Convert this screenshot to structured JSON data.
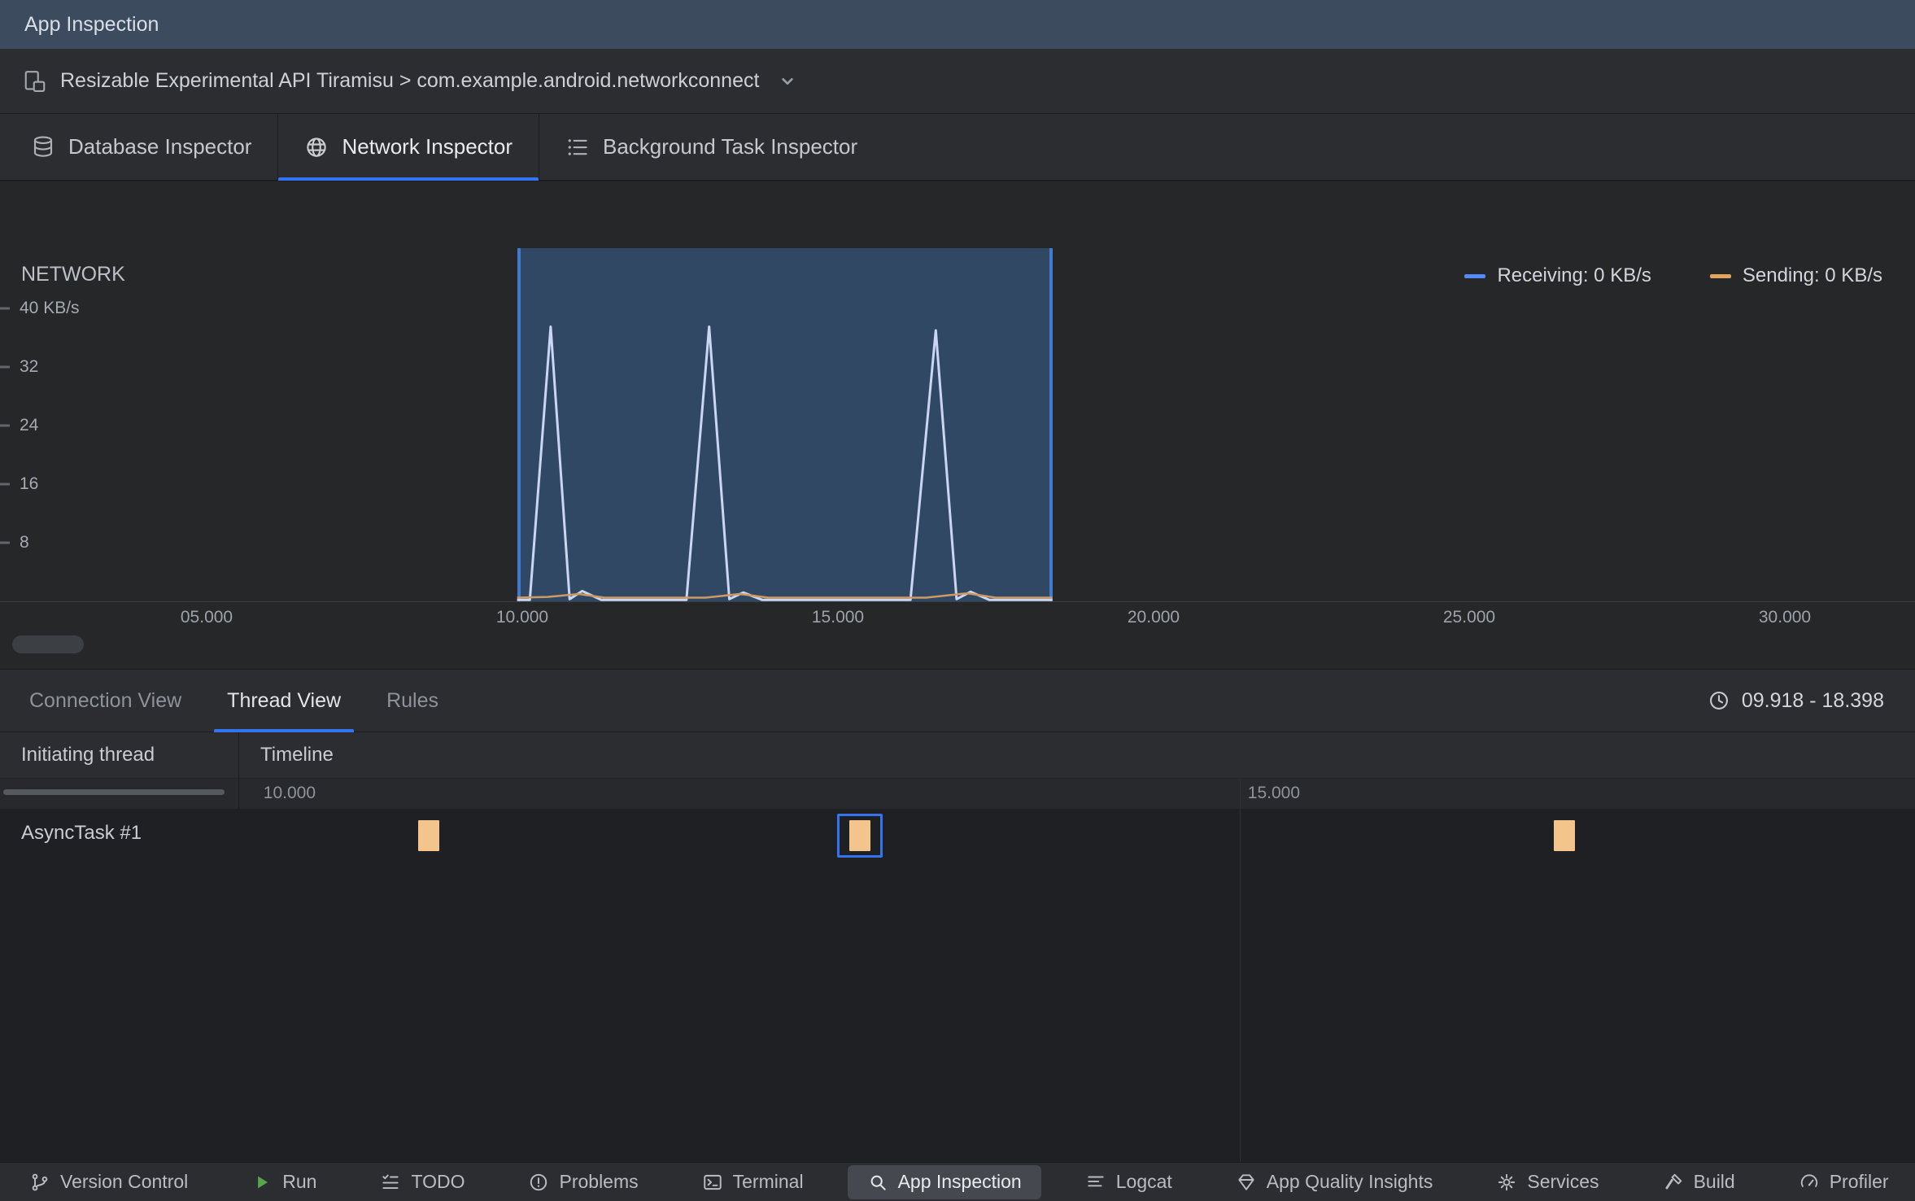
{
  "window": {
    "title": "App Inspection"
  },
  "process_bar": {
    "icon": "device-icon",
    "device_process": "Resizable Experimental API Tiramisu > com.example.android.networkconnect",
    "dropdown_icon": "chevron-down-icon"
  },
  "inspector_tabs": {
    "tabs": [
      {
        "label": "Database Inspector",
        "icon": "database-icon",
        "selected": false
      },
      {
        "label": "Network Inspector",
        "icon": "globe-icon",
        "selected": true
      },
      {
        "label": "Background Task Inspector",
        "icon": "checklist-icon",
        "selected": false
      }
    ]
  },
  "network": {
    "title": "NETWORK",
    "legend": [
      {
        "label": "Receiving: 0 KB/s",
        "color": "#548AF7"
      },
      {
        "label": "Sending: 0 KB/s",
        "color": "#E0A45C"
      }
    ]
  },
  "chart_data": {
    "type": "line",
    "title": "NETWORK",
    "ylabel": "KB/s",
    "ylim": [
      0,
      44
    ],
    "xlim_seconds": [
      3.7,
      32.0
    ],
    "grid": false,
    "legend_position": "top-right",
    "y_axis": {
      "ticks": [
        {
          "value": 8,
          "label": "8"
        },
        {
          "value": 16,
          "label": "16"
        },
        {
          "value": 24,
          "label": "24"
        },
        {
          "value": 32,
          "label": "32"
        },
        {
          "value": 40,
          "label": "40 KB/s"
        }
      ]
    },
    "x_axis": {
      "ticks": [
        {
          "value": 5,
          "label": "05.000"
        },
        {
          "value": 10,
          "label": "10.000"
        },
        {
          "value": 15,
          "label": "15.000"
        },
        {
          "value": 20,
          "label": "20.000"
        },
        {
          "value": 25,
          "label": "25.000"
        },
        {
          "value": 30,
          "label": "30.000"
        }
      ]
    },
    "selection": {
      "start": 9.918,
      "end": 18.398
    },
    "series": [
      {
        "name": "Receiving",
        "unit": "KB/s",
        "color": "#C9D7F2",
        "current_value": 0,
        "points": [
          [
            9.918,
            0.2
          ],
          [
            10.12,
            0.2
          ],
          [
            10.45,
            37.5
          ],
          [
            10.75,
            0.3
          ],
          [
            10.95,
            1.4
          ],
          [
            11.25,
            0.2
          ],
          [
            12.6,
            0.2
          ],
          [
            12.96,
            37.5
          ],
          [
            13.28,
            0.3
          ],
          [
            13.5,
            1.2
          ],
          [
            13.8,
            0.2
          ],
          [
            16.15,
            0.2
          ],
          [
            16.55,
            37.0
          ],
          [
            16.88,
            0.3
          ],
          [
            17.1,
            1.3
          ],
          [
            17.4,
            0.2
          ],
          [
            18.398,
            0.2
          ]
        ]
      },
      {
        "name": "Sending",
        "unit": "KB/s",
        "color": "#CE9A61",
        "current_value": 0,
        "points": [
          [
            9.918,
            0.5
          ],
          [
            10.4,
            0.6
          ],
          [
            10.9,
            1.0
          ],
          [
            11.3,
            0.5
          ],
          [
            12.9,
            0.5
          ],
          [
            13.45,
            1.0
          ],
          [
            13.9,
            0.5
          ],
          [
            16.4,
            0.5
          ],
          [
            17.05,
            1.1
          ],
          [
            17.5,
            0.5
          ],
          [
            18.398,
            0.5
          ]
        ]
      }
    ]
  },
  "thread_view": {
    "tabs": [
      {
        "label": "Connection View",
        "selected": false
      },
      {
        "label": "Thread View",
        "selected": true
      },
      {
        "label": "Rules",
        "selected": false
      }
    ],
    "range_icon": "clock-icon",
    "selected_range": "09.918 - 18.398",
    "table": {
      "columns": [
        "Initiating thread",
        "Timeline"
      ],
      "timeline_ticks": [
        {
          "label": "10.000",
          "value": 10,
          "gridline": false
        },
        {
          "label": "15.000",
          "value": 15,
          "gridline": true
        }
      ],
      "rows": [
        {
          "thread": "AsyncTask #1",
          "events": [
            {
              "time": 10.88,
              "selected": false
            },
            {
              "time": 13.07,
              "selected": true
            },
            {
              "time": 16.65,
              "selected": false
            }
          ]
        }
      ]
    }
  },
  "status_bar": {
    "items": [
      {
        "label": "Version Control",
        "icon": "branch-icon",
        "selected": false
      },
      {
        "label": "Run",
        "icon": "run-icon",
        "selected": false
      },
      {
        "label": "TODO",
        "icon": "todo-icon",
        "selected": false
      },
      {
        "label": "Problems",
        "icon": "problems-icon",
        "selected": false
      },
      {
        "label": "Terminal",
        "icon": "terminal-icon",
        "selected": false
      },
      {
        "label": "App Inspection",
        "icon": "app-inspection-icon",
        "selected": true
      },
      {
        "label": "Logcat",
        "icon": "logcat-icon",
        "selected": false
      },
      {
        "label": "App Quality Insights",
        "icon": "insights-icon",
        "selected": false
      },
      {
        "label": "Services",
        "icon": "services-icon",
        "selected": false
      },
      {
        "label": "Build",
        "icon": "build-icon",
        "selected": false
      },
      {
        "label": "Profiler",
        "icon": "profiler-icon",
        "selected": false
      }
    ]
  },
  "colors": {
    "accent_blue": "#3574F0",
    "selection_fill": "rgba(67,118,187,0.42)",
    "selection_edge": "#4379CE",
    "event_block": "#F3C48B",
    "titlebar": "#3D4B5F",
    "panel": "#2B2D30",
    "chart_bg": "#252729"
  }
}
